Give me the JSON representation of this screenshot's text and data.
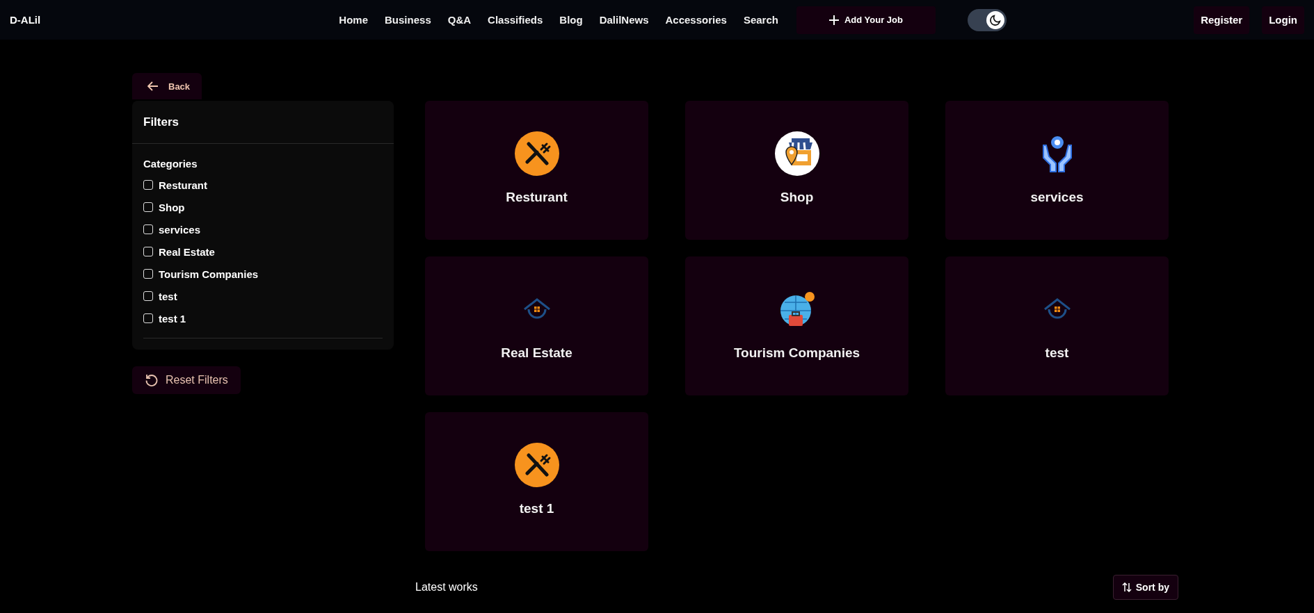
{
  "navbar": {
    "logo": "D-ALil",
    "links": [
      "Home",
      "Business",
      "Q&A",
      "Classifieds",
      "Blog",
      "DalilNews",
      "Accessories",
      "Search"
    ],
    "add_job": "Add Your Job",
    "theme_toggle": {
      "on": true
    },
    "auth": [
      "Register",
      "Login"
    ]
  },
  "back": "Back",
  "filters": {
    "title": "Filters",
    "heading": "Categories",
    "items": [
      {
        "label": "Resturant",
        "checked": false
      },
      {
        "label": "Shop",
        "checked": false
      },
      {
        "label": "services",
        "checked": false
      },
      {
        "label": "Real Estate",
        "checked": false
      },
      {
        "label": "Tourism Companies",
        "checked": false
      },
      {
        "label": "test",
        "checked": false
      },
      {
        "label": "test 1",
        "checked": false
      }
    ]
  },
  "reset": "Reset Filters",
  "cards": [
    {
      "label": "Resturant",
      "kind": "cutlery"
    },
    {
      "label": "Shop",
      "kind": "shop"
    },
    {
      "label": "services",
      "kind": "service"
    },
    {
      "label": "Real Estate",
      "kind": "house"
    },
    {
      "label": "Tourism Companies",
      "kind": "globe"
    },
    {
      "label": "test",
      "kind": "house"
    },
    {
      "label": "test 1",
      "kind": "cutlery"
    }
  ],
  "latest": {
    "title": "Latest works",
    "sort": "Sort by"
  }
}
